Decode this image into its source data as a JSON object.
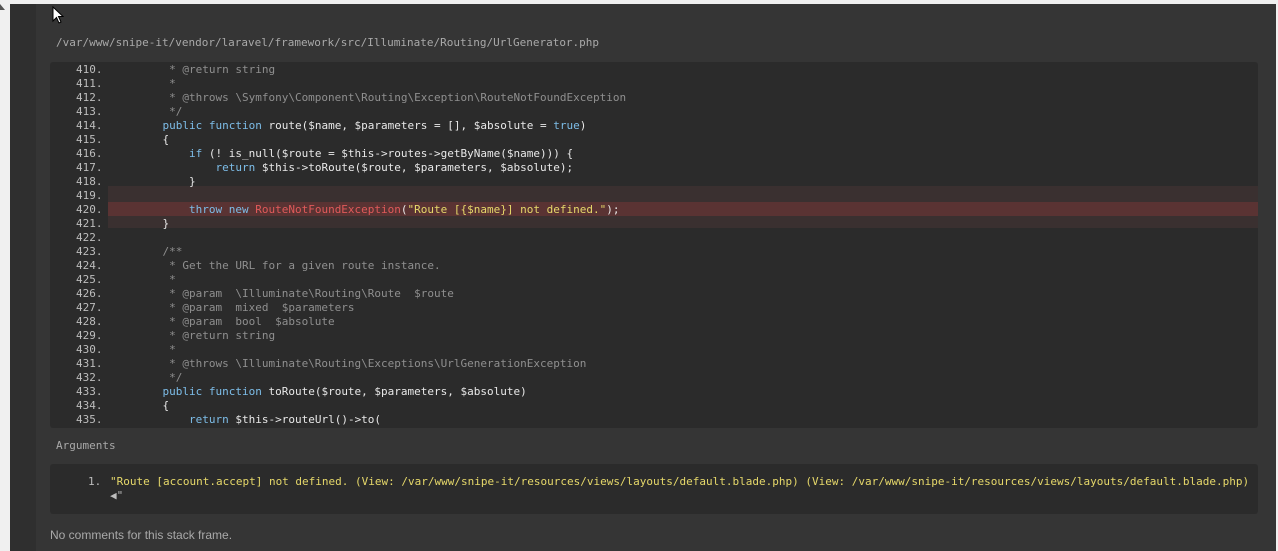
{
  "file_path": "/var/www/snipe-it/vendor/laravel/framework/src/Illuminate/Routing/UrlGenerator.php",
  "code_lines": [
    {
      "ln": "410.",
      "text": "     * @return string",
      "cls": "c-comment"
    },
    {
      "ln": "411.",
      "text": "     *",
      "cls": "c-comment"
    },
    {
      "ln": "412.",
      "text": "     * @throws \\Symfony\\Component\\Routing\\Exception\\RouteNotFoundException",
      "cls": "c-comment"
    },
    {
      "ln": "413.",
      "text": "     */",
      "cls": "c-comment"
    },
    {
      "ln": "414.",
      "text": "",
      "cls": "c-plain"
    },
    {
      "ln": "415.",
      "text": "    {",
      "cls": "c-plain"
    },
    {
      "ln": "416.",
      "text": "",
      "cls": "c-plain"
    },
    {
      "ln": "417.",
      "text": "",
      "cls": "c-plain"
    },
    {
      "ln": "418.",
      "text": "        }",
      "cls": "c-plain"
    },
    {
      "ln": "419.",
      "text": "",
      "cls": "c-plain"
    },
    {
      "ln": "420.",
      "text": "",
      "cls": "c-plain"
    },
    {
      "ln": "421.",
      "text": "    }",
      "cls": "c-plain"
    },
    {
      "ln": "422.",
      "text": "",
      "cls": "c-plain"
    },
    {
      "ln": "423.",
      "text": "    /**",
      "cls": "c-comment"
    },
    {
      "ln": "424.",
      "text": "     * Get the URL for a given route instance.",
      "cls": "c-comment"
    },
    {
      "ln": "425.",
      "text": "     *",
      "cls": "c-comment"
    },
    {
      "ln": "426.",
      "text": "     * @param  \\Illuminate\\Routing\\Route  $route",
      "cls": "c-comment"
    },
    {
      "ln": "427.",
      "text": "     * @param  mixed  $parameters",
      "cls": "c-comment"
    },
    {
      "ln": "428.",
      "text": "     * @param  bool  $absolute",
      "cls": "c-comment"
    },
    {
      "ln": "429.",
      "text": "     * @return string",
      "cls": "c-comment"
    },
    {
      "ln": "430.",
      "text": "     *",
      "cls": "c-comment"
    },
    {
      "ln": "431.",
      "text": "     * @throws \\Illuminate\\Routing\\Exceptions\\UrlGenerationException",
      "cls": "c-comment"
    },
    {
      "ln": "432.",
      "text": "     */",
      "cls": "c-comment"
    },
    {
      "ln": "433.",
      "text": "",
      "cls": "c-plain"
    },
    {
      "ln": "434.",
      "text": "    {",
      "cls": "c-plain"
    },
    {
      "ln": "435.",
      "text": "",
      "cls": "c-plain"
    }
  ],
  "rich_lines": {
    "414": [
      [
        "    ",
        "c-plain"
      ],
      [
        "public function",
        "c-kw"
      ],
      [
        " route($name, $parameters = [], $absolute = ",
        "c-plain"
      ],
      [
        "true",
        "c-kw"
      ],
      [
        ")",
        "c-plain"
      ]
    ],
    "416": [
      [
        "        ",
        "c-plain"
      ],
      [
        "if",
        "c-kw"
      ],
      [
        " (! is_null($route = $this->routes->getByName($name))) {",
        "c-plain"
      ]
    ],
    "417": [
      [
        "            ",
        "c-plain"
      ],
      [
        "return",
        "c-kw"
      ],
      [
        " $this->toRoute($route, $parameters, $absolute);",
        "c-plain"
      ]
    ],
    "420": [
      [
        "        ",
        "c-plain"
      ],
      [
        "throw new",
        "c-kw"
      ],
      [
        " ",
        "c-plain"
      ],
      [
        "RouteNotFoundException",
        "c-ex"
      ],
      [
        "(",
        "c-plain"
      ],
      [
        "\"Route [{$name}] not defined.\"",
        "c-str"
      ],
      [
        ");",
        "c-plain"
      ]
    ],
    "433": [
      [
        "    ",
        "c-plain"
      ],
      [
        "public function",
        "c-kw"
      ],
      [
        " toRoute($route, $parameters, $absolute)",
        "c-plain"
      ]
    ],
    "435": [
      [
        "        ",
        "c-plain"
      ],
      [
        "return",
        "c-kw"
      ],
      [
        " $this->routeUrl()->to(",
        "c-plain"
      ]
    ]
  },
  "arguments_label": "Arguments",
  "arguments": [
    {
      "num": "1.",
      "text": "\"Route [account.accept] not defined. (View: /var/www/snipe-it/resources/views/layouts/default.blade.php) (View: /var/www/snipe-it/resources/views/layouts/default.blade.php)",
      "cont": "◀\""
    }
  ],
  "no_comments": "No comments for this stack frame."
}
